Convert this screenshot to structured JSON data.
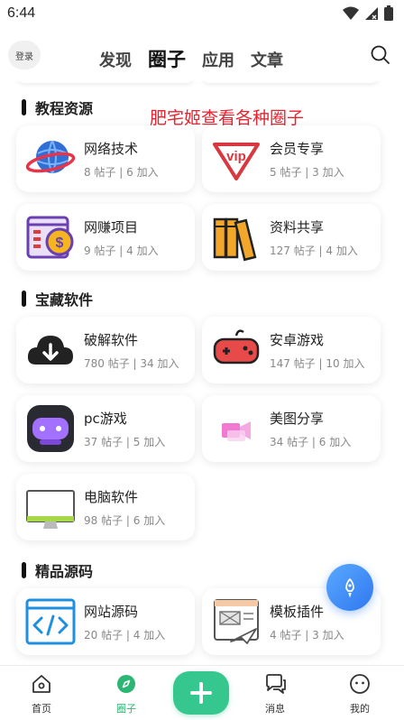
{
  "status_bar": {
    "time": "6:44"
  },
  "header": {
    "login": "登录",
    "tabs": [
      {
        "label": "发现",
        "active": false
      },
      {
        "label": "圈子",
        "active": true
      },
      {
        "label": "应用",
        "active": false
      },
      {
        "label": "文章",
        "active": false
      }
    ]
  },
  "overlay_text": "肥宅姬查看各种圈子",
  "sections": [
    {
      "title": "教程资源",
      "cards": [
        {
          "name": "网络技术",
          "meta": "8 帖子 | 6 加入",
          "icon": "globe-icon"
        },
        {
          "name": "会员专享",
          "meta": "5 帖子 | 3 加入",
          "icon": "vip-icon"
        },
        {
          "name": "网赚项目",
          "meta": "9 帖子 | 4 加入",
          "icon": "money-icon"
        },
        {
          "name": "资料共享",
          "meta": "127 帖子 | 4 加入",
          "icon": "books-icon"
        }
      ]
    },
    {
      "title": "宝藏软件",
      "cards": [
        {
          "name": "破解软件",
          "meta": "780 帖子 | 34 加入",
          "icon": "cloud-download-icon"
        },
        {
          "name": "安卓游戏",
          "meta": "147 帖子 | 10 加入",
          "icon": "gamepad-icon"
        },
        {
          "name": "pc游戏",
          "meta": "37 帖子 | 5 加入",
          "icon": "game-controller-icon"
        },
        {
          "name": "美图分享",
          "meta": "34 帖子 | 6 加入",
          "icon": "video-camera-icon"
        },
        {
          "name": "电脑软件",
          "meta": "98 帖子 | 6 加入",
          "icon": "monitor-icon"
        }
      ]
    },
    {
      "title": "精品源码",
      "cards": [
        {
          "name": "网站源码",
          "meta": "20 帖子 | 4 加入",
          "icon": "code-icon"
        },
        {
          "name": "模板插件",
          "meta": "4 帖子 | 3 加入",
          "icon": "template-icon"
        }
      ]
    }
  ],
  "bottom_nav": [
    {
      "label": "首页",
      "icon": "home-icon",
      "active": false
    },
    {
      "label": "圈子",
      "icon": "compass-icon",
      "active": true
    },
    {
      "label": "",
      "icon": "plus-icon",
      "active": false
    },
    {
      "label": "消息",
      "icon": "chat-icon",
      "active": false
    },
    {
      "label": "我的",
      "icon": "profile-icon",
      "active": false
    }
  ],
  "colors": {
    "accent": "#36c78f",
    "active_nav": "#2bb673",
    "overlay_red": "#e8232f",
    "fab_blue": "#2f78f0"
  }
}
